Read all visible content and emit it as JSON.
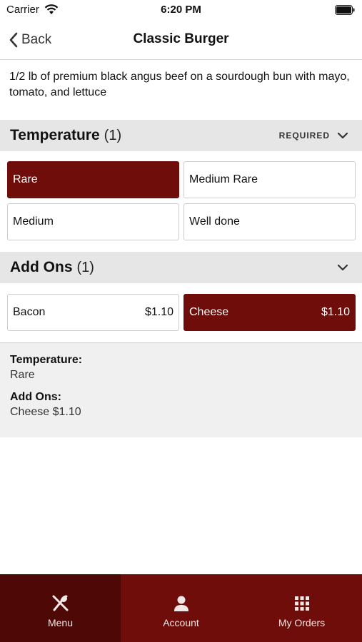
{
  "status_bar": {
    "carrier": "Carrier",
    "time": "6:20 PM"
  },
  "nav": {
    "back_label": "Back",
    "title": "Classic Burger"
  },
  "description": "1/2 lb of premium black angus beef on a sourdough bun with mayo, tomato, and lettuce",
  "sections": {
    "temperature": {
      "title": "Temperature",
      "count": "(1)",
      "required": "REQUIRED",
      "options": [
        {
          "label": "Rare",
          "selected": true
        },
        {
          "label": "Medium Rare",
          "selected": false
        },
        {
          "label": "Medium",
          "selected": false
        },
        {
          "label": "Well done",
          "selected": false
        }
      ]
    },
    "add_ons": {
      "title": "Add Ons",
      "count": "(1)",
      "options": [
        {
          "label": "Bacon",
          "price": "$1.10",
          "selected": false
        },
        {
          "label": "Cheese",
          "price": "$1.10",
          "selected": true
        }
      ]
    }
  },
  "summary": {
    "temperature_label": "Temperature:",
    "temperature_value": "Rare",
    "add_ons_label": "Add Ons:",
    "add_ons_value": "Cheese $1.10"
  },
  "tabs": [
    {
      "label": "Menu",
      "icon": "utensils-icon",
      "active": true
    },
    {
      "label": "Account",
      "icon": "person-icon",
      "active": false
    },
    {
      "label": "My Orders",
      "icon": "grid-icon",
      "active": false
    }
  ],
  "colors": {
    "accent": "#6e0d09",
    "accent_dark": "#4e0906",
    "section_bg": "#e6e6e6"
  }
}
